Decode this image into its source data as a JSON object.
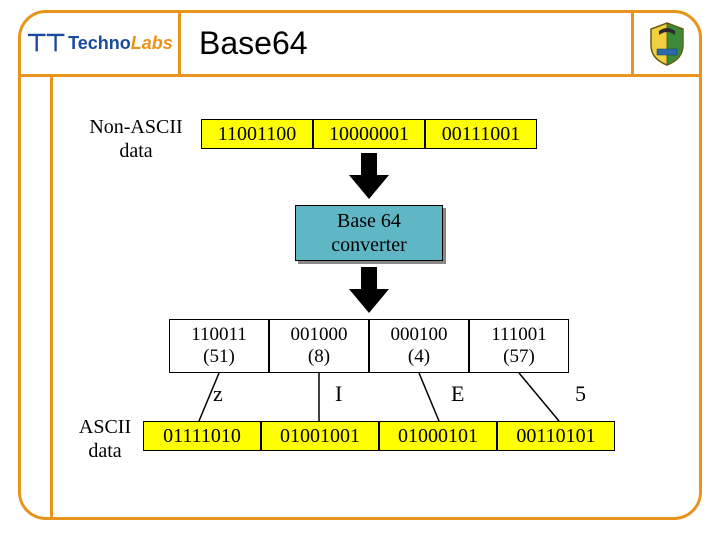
{
  "header": {
    "brand_prefix": "Techno",
    "brand_suffix": "Labs",
    "title": "Base64"
  },
  "diagram": {
    "input_label_l1": "Non-ASCII",
    "input_label_l2": "data",
    "input_bytes": [
      "11001100",
      "10000001",
      "00111001"
    ],
    "converter_l1": "Base 64",
    "converter_l2": "converter",
    "sixbit_groups": [
      {
        "bits": "110011",
        "dec": "(51)"
      },
      {
        "bits": "001000",
        "dec": "(8)"
      },
      {
        "bits": "000100",
        "dec": "(4)"
      },
      {
        "bits": "111001",
        "dec": "(57)"
      }
    ],
    "chars": [
      "z",
      "I",
      "E",
      "5"
    ],
    "output_label_l1": "ASCII",
    "output_label_l2": "data",
    "output_bytes": [
      "01111010",
      "01001001",
      "01000101",
      "00110101"
    ]
  }
}
